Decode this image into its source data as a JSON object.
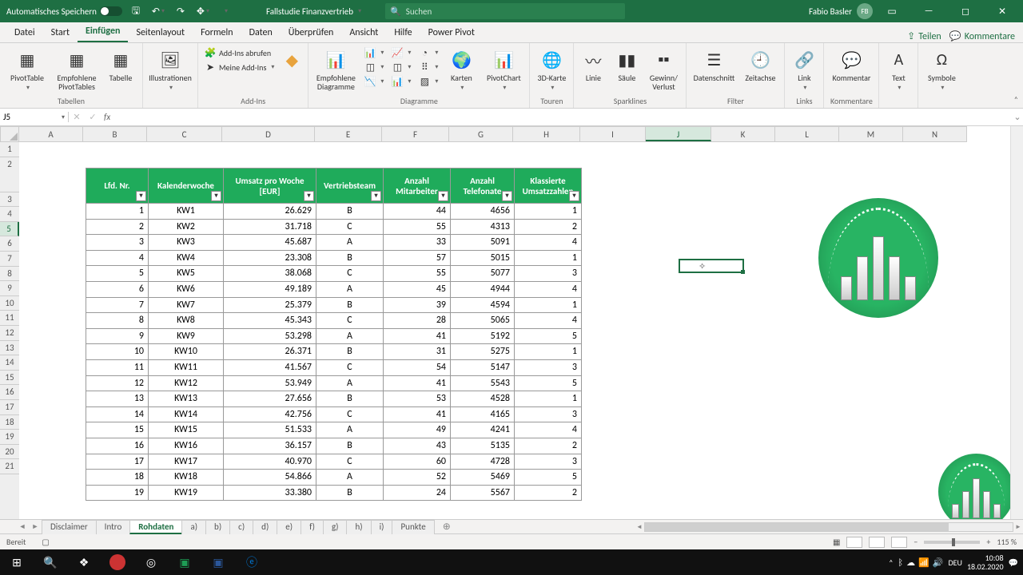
{
  "titlebar": {
    "autosave_label": "Automatisches Speichern",
    "filename": "Fallstudie Finanzvertrieb",
    "search_placeholder": "Suchen",
    "user_name": "Fabio Basler",
    "user_initials": "FB"
  },
  "tabs": {
    "items": [
      "Datei",
      "Start",
      "Einfügen",
      "Seitenlayout",
      "Formeln",
      "Daten",
      "Überprüfen",
      "Ansicht",
      "Hilfe",
      "Power Pivot"
    ],
    "active_index": 2,
    "share": "Teilen",
    "comments": "Kommentare"
  },
  "ribbon": {
    "tabellen": {
      "label": "Tabellen",
      "pivottable": "PivotTable",
      "recommended": "Empfohlene PivotTables",
      "table": "Tabelle"
    },
    "illu": {
      "label": "Illustrationen",
      "btn": "Illustrationen"
    },
    "addins": {
      "label": "Add-Ins",
      "get": "Add-Ins abrufen",
      "my": "Meine Add-Ins"
    },
    "charts": {
      "label": "Diagramme",
      "recommended": "Empfohlene Diagramme",
      "maps": "Karten",
      "pivotchart": "PivotChart"
    },
    "tours": {
      "label": "Touren",
      "map3d": "3D-Karte"
    },
    "sparklines": {
      "label": "Sparklines",
      "line": "Linie",
      "column": "Säule",
      "winloss": "Gewinn/\nVerlust"
    },
    "filter": {
      "label": "Filter",
      "slicer": "Datenschnitt",
      "timeline": "Zeitachse"
    },
    "links": {
      "label": "Links",
      "link": "Link"
    },
    "comments": {
      "label": "Kommentare",
      "comment": "Kommentar"
    },
    "text": {
      "label": "Text",
      "btn": "Text"
    },
    "symbols": {
      "label": "Symbole",
      "btn": "Symbole"
    }
  },
  "formula_bar": {
    "name_box": "J5",
    "fx": "fx",
    "value": ""
  },
  "grid": {
    "columns": [
      "A",
      "B",
      "C",
      "D",
      "E",
      "F",
      "G",
      "H",
      "I",
      "J",
      "K",
      "L",
      "M",
      "N"
    ],
    "active_col_index": 9,
    "rows": [
      1,
      2,
      3,
      4,
      5,
      6,
      7,
      8,
      9,
      10,
      11,
      12,
      13,
      14,
      15,
      16,
      17,
      18,
      19,
      20,
      21
    ],
    "active_row": 5,
    "headers": [
      "Lfd. Nr.",
      "Kalenderwoche",
      "Umsatz pro Woche [EUR]",
      "Vertriebsteam",
      "Anzahl Mitarbeiter",
      "Anzahl Telefonate",
      "Klassierte Umsatzzahlen"
    ],
    "data": [
      [
        1,
        "KW1",
        "26.629",
        "B",
        44,
        4656,
        1
      ],
      [
        2,
        "KW2",
        "31.718",
        "C",
        55,
        4313,
        2
      ],
      [
        3,
        "KW3",
        "45.687",
        "A",
        33,
        5091,
        4
      ],
      [
        4,
        "KW4",
        "23.308",
        "B",
        57,
        5015,
        1
      ],
      [
        5,
        "KW5",
        "38.068",
        "C",
        55,
        5077,
        3
      ],
      [
        6,
        "KW6",
        "49.189",
        "A",
        45,
        4944,
        4
      ],
      [
        7,
        "KW7",
        "25.379",
        "B",
        39,
        4594,
        1
      ],
      [
        8,
        "KW8",
        "45.343",
        "C",
        28,
        5065,
        4
      ],
      [
        9,
        "KW9",
        "53.298",
        "A",
        41,
        5192,
        5
      ],
      [
        10,
        "KW10",
        "26.371",
        "B",
        31,
        5275,
        1
      ],
      [
        11,
        "KW11",
        "41.567",
        "C",
        54,
        5147,
        3
      ],
      [
        12,
        "KW12",
        "53.949",
        "A",
        41,
        5543,
        5
      ],
      [
        13,
        "KW13",
        "27.656",
        "B",
        53,
        4528,
        1
      ],
      [
        14,
        "KW14",
        "42.756",
        "C",
        41,
        4165,
        3
      ],
      [
        15,
        "KW15",
        "51.533",
        "A",
        49,
        4241,
        4
      ],
      [
        16,
        "KW16",
        "36.157",
        "B",
        43,
        5135,
        2
      ],
      [
        17,
        "KW17",
        "40.970",
        "C",
        60,
        4728,
        3
      ],
      [
        18,
        "KW18",
        "54.866",
        "A",
        52,
        5469,
        5
      ],
      [
        19,
        "KW19",
        "33.380",
        "B",
        24,
        5567,
        2
      ]
    ]
  },
  "sheet_tabs": {
    "items": [
      "Disclaimer",
      "Intro",
      "Rohdaten",
      "a)",
      "b)",
      "c)",
      "d)",
      "e)",
      "f)",
      "g)",
      "h)",
      "i)",
      "Punkte"
    ],
    "active_index": 2
  },
  "status": {
    "ready": "Bereit",
    "zoom": "115 %"
  },
  "taskbar": {
    "lang": "DEU",
    "time": "10:08",
    "date": "18.02.2020"
  }
}
